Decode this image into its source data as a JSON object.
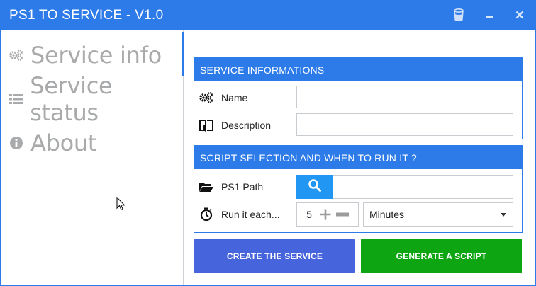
{
  "window": {
    "title": "PS1 TO SERVICE - V1.0",
    "accent_color": "#2d7be8"
  },
  "titlebar": {
    "buttons": [
      {
        "name": "bucket-icon"
      },
      {
        "name": "minimize-icon"
      },
      {
        "name": "close-icon"
      }
    ]
  },
  "sidebar": {
    "items": [
      {
        "label": "Service info",
        "icon": "gears-icon",
        "active": true
      },
      {
        "label": "Service status",
        "icon": "list-icon",
        "active": false
      },
      {
        "label": "About",
        "icon": "info-icon",
        "active": false
      }
    ]
  },
  "service_section": {
    "header": "SERVICE INFORMATIONS",
    "name_label": "Name",
    "name_value": "",
    "description_label": "Description",
    "description_value": ""
  },
  "script_section": {
    "header": "SCRIPT SELECTION AND WHEN TO RUN IT ?",
    "path_label": "PS1 Path",
    "path_value": "",
    "interval_label": "Run it each...",
    "interval_value": "5",
    "unit_selected": "Minutes"
  },
  "actions": {
    "create_label": "CREATE THE SERVICE",
    "generate_label": "GENERATE A SCRIPT",
    "create_color": "#4664dc",
    "generate_color": "#0ea512"
  }
}
